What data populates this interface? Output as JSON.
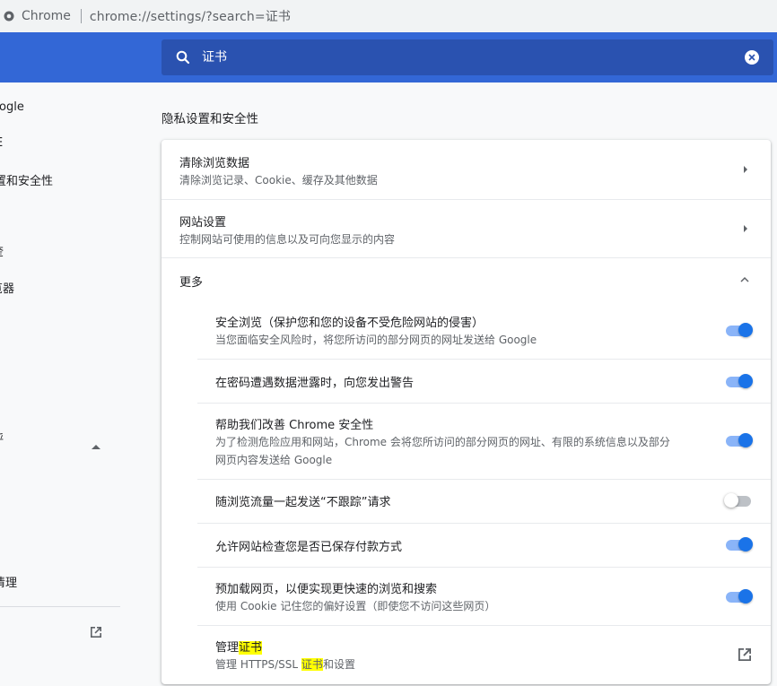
{
  "addressbar": {
    "app_name": "Chrome",
    "url": "chrome://settings/?search=证书"
  },
  "search": {
    "query": "证书",
    "icon": "search-icon",
    "clear_icon": "clear-icon"
  },
  "sidebar": {
    "items": [
      {
        "label": "ogle"
      },
      {
        "label": "E"
      },
      {
        "label": "置和安全性"
      },
      {
        "label": "奎"
      },
      {
        "label": "览器"
      },
      {
        "label": "呼"
      },
      {
        "label": "清理"
      }
    ],
    "collapse_icon": "chevron-up-icon",
    "external_icon": "open-in-new-icon"
  },
  "section": {
    "title": "隐私设置和安全性"
  },
  "rows": {
    "clear_data": {
      "title": "清除浏览数据",
      "sub": "清除浏览记录、Cookie、缓存及其他数据"
    },
    "site_settings": {
      "title": "网站设置",
      "sub": "控制网站可使用的信息以及可向您显示的内容"
    },
    "more": {
      "title": "更多"
    }
  },
  "toggles": [
    {
      "title": "安全浏览（保护您和您的设备不受危险网站的侵害）",
      "sub": "当您面临安全风险时，将您所访问的部分网页的网址发送给 Google",
      "on": true
    },
    {
      "title": "在密码遭遇数据泄露时，向您发出警告",
      "sub": "",
      "on": true
    },
    {
      "title": "帮助我们改善 Chrome 安全性",
      "sub": "为了检测危险应用和网站，Chrome 会将您所访问的部分网页的网址、有限的系统信息以及部分",
      "sub2": "网页内容发送给 Google",
      "on": true
    },
    {
      "title": "随浏览流量一起发送“不跟踪”请求",
      "sub": "",
      "on": false
    },
    {
      "title": "允许网站检查您是否已保存付款方式",
      "sub": "",
      "on": true
    },
    {
      "title": "预加载网页，以便实现更快速的浏览和搜索",
      "sub": "使用 Cookie 记住您的偏好设置（即使您不访问这些网页）",
      "on": true
    }
  ],
  "certs": {
    "title_prefix": "管理",
    "title_highlight": "证书",
    "sub_prefix": "管理 HTTPS/SSL ",
    "sub_highlight": "证书",
    "sub_suffix": "和设置"
  },
  "colors": {
    "header": "#3367d6",
    "search_bg": "#2a52b0",
    "toggle_on": "#1a73e8",
    "highlight": "#ffff00"
  }
}
